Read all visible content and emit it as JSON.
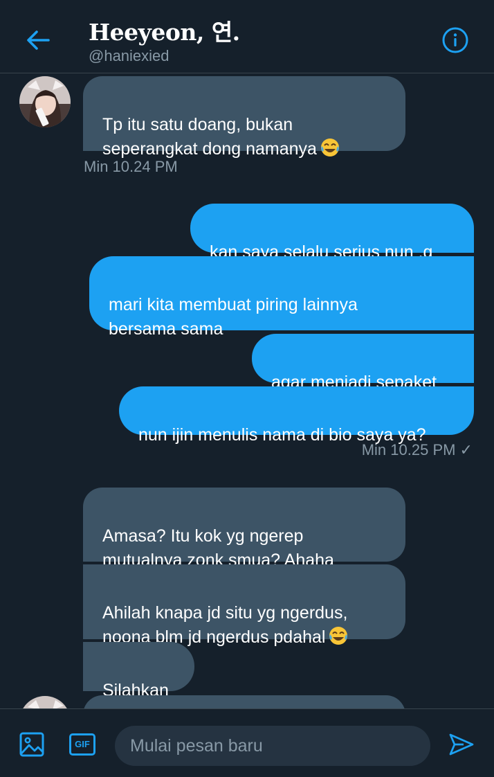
{
  "header": {
    "title": "Heeyeon, 연.",
    "handle": "@haniexied",
    "back_icon": "arrow-left-icon",
    "info_icon": "info-icon"
  },
  "messages": [
    {
      "side": "in",
      "text": "Tp itu satu doang, bukan\nseperangkat dong namanya",
      "emoji": "laughing-tears-emoji"
    },
    {
      "side": "in-meta",
      "text": "Min 10.24 PM"
    },
    {
      "side": "out",
      "text": "kan saya selalu serius nun .g"
    },
    {
      "side": "out",
      "text": "mari kita membuat piring lainnya\nbersama sama"
    },
    {
      "side": "out",
      "text": "agar menjadi sepaket"
    },
    {
      "side": "out",
      "text": "nun ijin menulis nama di bio saya ya?"
    },
    {
      "side": "out-meta",
      "text": "Min 10.25 PM ✓"
    },
    {
      "side": "in",
      "text": "Amasa? Itu kok yg ngerep\nmutualnya zonk smua? Ahaha"
    },
    {
      "side": "in",
      "text": "Ahilah knapa jd situ yg ngerdus,\nnoona blm jd ngerdus pdahal",
      "emoji": "laughing-tears-emoji"
    },
    {
      "side": "in",
      "text": "Silahkan"
    }
  ],
  "composer": {
    "placeholder": "Mulai pesan baru",
    "image_icon": "image-icon",
    "gif_label": "GIF",
    "send_icon": "send-icon"
  },
  "colors": {
    "background": "#15202b",
    "incoming_bubble": "#3d5466",
    "outgoing_bubble": "#1da1f2",
    "accent": "#1da1f2",
    "muted_text": "#8899a6"
  }
}
